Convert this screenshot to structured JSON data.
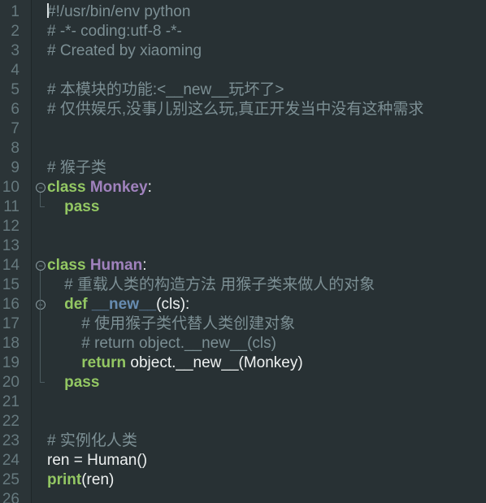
{
  "editor": {
    "lines": [
      {
        "n": "1",
        "t": [
          {
            "c": "comment",
            "s": "#!/usr/bin/env python"
          }
        ]
      },
      {
        "n": "2",
        "t": [
          {
            "c": "comment",
            "s": "# -*- coding:utf-8 -*-"
          }
        ]
      },
      {
        "n": "3",
        "t": [
          {
            "c": "comment",
            "s": "# Created by xiaoming"
          }
        ]
      },
      {
        "n": "4",
        "t": []
      },
      {
        "n": "5",
        "t": [
          {
            "c": "comment",
            "s": "# 本模块的功能:<__new__玩坏了>"
          }
        ]
      },
      {
        "n": "6",
        "t": [
          {
            "c": "comment",
            "s": "# 仅供娱乐,没事儿别这么玩,真正开发当中没有这种需求"
          }
        ]
      },
      {
        "n": "7",
        "t": []
      },
      {
        "n": "8",
        "t": []
      },
      {
        "n": "9",
        "t": [
          {
            "c": "comment",
            "s": "# 猴子类"
          }
        ]
      },
      {
        "n": "10",
        "t": [
          {
            "c": "kw",
            "s": "class "
          },
          {
            "c": "cls",
            "s": "Monkey"
          },
          {
            "c": "text",
            "s": ":"
          }
        ]
      },
      {
        "n": "11",
        "t": [
          {
            "c": "text",
            "s": "    "
          },
          {
            "c": "kw",
            "s": "pass"
          }
        ]
      },
      {
        "n": "12",
        "t": []
      },
      {
        "n": "13",
        "t": []
      },
      {
        "n": "14",
        "t": [
          {
            "c": "kw",
            "s": "class "
          },
          {
            "c": "cls",
            "s": "Human"
          },
          {
            "c": "text",
            "s": ":"
          }
        ]
      },
      {
        "n": "15",
        "t": [
          {
            "c": "text",
            "s": "    "
          },
          {
            "c": "comment",
            "s": "# 重载人类的构造方法 用猴子类来做人的对象"
          }
        ]
      },
      {
        "n": "16",
        "t": [
          {
            "c": "text",
            "s": "    "
          },
          {
            "c": "kw",
            "s": "def "
          },
          {
            "c": "func",
            "s": "__new__"
          },
          {
            "c": "text",
            "s": "(cls):"
          }
        ]
      },
      {
        "n": "17",
        "t": [
          {
            "c": "text",
            "s": "        "
          },
          {
            "c": "comment",
            "s": "# 使用猴子类代替人类创建对象"
          }
        ]
      },
      {
        "n": "18",
        "t": [
          {
            "c": "text",
            "s": "        "
          },
          {
            "c": "comment",
            "s": "# return object.__new__(cls)"
          }
        ]
      },
      {
        "n": "19",
        "t": [
          {
            "c": "text",
            "s": "        "
          },
          {
            "c": "kw",
            "s": "return "
          },
          {
            "c": "text",
            "s": "object.__new__(Monkey)"
          }
        ]
      },
      {
        "n": "20",
        "t": [
          {
            "c": "text",
            "s": "    "
          },
          {
            "c": "kw",
            "s": "pass"
          }
        ]
      },
      {
        "n": "21",
        "t": []
      },
      {
        "n": "22",
        "t": []
      },
      {
        "n": "23",
        "t": [
          {
            "c": "comment",
            "s": "# 实例化人类"
          }
        ]
      },
      {
        "n": "24",
        "t": [
          {
            "c": "text",
            "s": "ren = Human()"
          }
        ]
      },
      {
        "n": "25",
        "t": [
          {
            "c": "kw",
            "s": "print"
          },
          {
            "c": "text",
            "s": "(ren)"
          }
        ]
      },
      {
        "n": "26",
        "t": []
      }
    ],
    "fold_markers": [
      "10",
      "14",
      "16"
    ],
    "colors": {
      "background": "#283134",
      "comment": "#7c8f94",
      "keyword": "#93c763",
      "class_name": "#a082bd",
      "function_name": "#678cb1",
      "text": "#eef1f1",
      "line_number": "#66797e"
    }
  }
}
